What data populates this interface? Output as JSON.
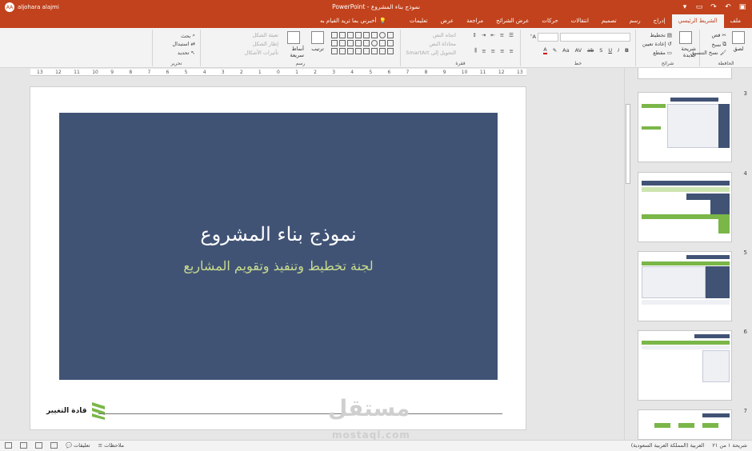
{
  "titlebar": {
    "doc_title": "نموذج بناء المشروع  -  PowerPoint",
    "user_name": "aljohara alajmi",
    "user_initials": "AA",
    "qat_icons": [
      "save-icon",
      "undo-icon",
      "redo-icon",
      "present-icon"
    ]
  },
  "tabs": {
    "items": [
      "ملف",
      "الشريط الرئيسي",
      "إدراج",
      "رسم",
      "تصميم",
      "انتقالات",
      "حركات",
      "عرض الشرائح",
      "مراجعة",
      "عرض",
      "تعليمات"
    ],
    "active_index": 1,
    "tellme": "أخبرني بما تريد القيام به"
  },
  "ribbon": {
    "clipboard": {
      "label": "الحافظة",
      "paste": "لصق",
      "cut": "قص",
      "copy": "نسخ",
      "format_painter": "نسخ التنسيق"
    },
    "slides": {
      "label": "شرائح",
      "new_slide": "شريحة جديدة",
      "layout": "تخطيط",
      "reset": "إعادة تعيين",
      "section": "مقطع"
    },
    "font": {
      "label": "خط"
    },
    "paragraph": {
      "label": "فقرة",
      "text_direction": "اتجاه النص",
      "align_text": "محاذاة النص",
      "smartart": "التحويل إلى SmartArt"
    },
    "drawing": {
      "label": "رسم",
      "arrange": "ترتيب",
      "quick_styles": "أنماط سريعة",
      "shape_fill": "تعبئة الشكل",
      "shape_outline": "إطار الشكل",
      "shape_effects": "تأثيرات الأشكال"
    },
    "editing": {
      "label": "تحرير",
      "find": "بحث",
      "replace": "استبدال",
      "select": "تحديد"
    }
  },
  "ruler": {
    "ticks": [
      "13",
      "12",
      "11",
      "10",
      "9",
      "8",
      "7",
      "6",
      "5",
      "4",
      "3",
      "2",
      "1",
      "0",
      "1",
      "2",
      "3",
      "4",
      "5",
      "6",
      "7",
      "8",
      "9",
      "10",
      "11",
      "12",
      "13"
    ]
  },
  "slide": {
    "title": "نموذج بناء المشروع",
    "subtitle": "لجنة تخطيط وتنفيذ وتقويم المشاريع",
    "logo_text": "قادة التغيير",
    "box_color": "#415375",
    "subtitle_color": "#c9dd8f"
  },
  "thumbnails": [
    {
      "number": "3"
    },
    {
      "number": "4"
    },
    {
      "number": "5"
    },
    {
      "number": "6"
    },
    {
      "number": "7"
    }
  ],
  "watermark": {
    "text": "مستقل",
    "url": "mostaql.com"
  },
  "statusbar": {
    "slide_info": "شريحة ١ من ٢١",
    "language": "العربية (المملكة العربية السعودية)",
    "notes": "ملاحظات",
    "comments": "تعليقات"
  },
  "colors": {
    "accent": "#c1421c",
    "green": "#7ab648"
  }
}
